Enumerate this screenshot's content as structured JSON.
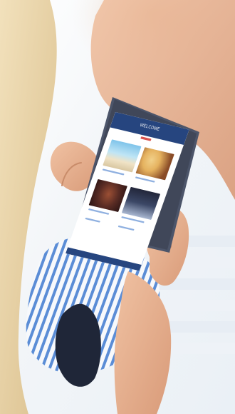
{
  "photo": {
    "subject": "person-holding-tablet",
    "colors": {
      "backdrop": "#f3efe9",
      "hair": "#e8d3a6",
      "skin": "#e3ad8c",
      "shirt_stripe_blue": "#5b8dd6",
      "shirt_white": "#f7f9fc",
      "tablet_body": "#4c556a",
      "screen_header": "#26457f",
      "screen_accent": "#d9534f"
    },
    "tablet_screen": {
      "header_title": "WELCOME",
      "tiles": [
        {
          "name": "beach-photo",
          "colors": [
            "#7fc4ea",
            "#f0e3c6"
          ]
        },
        {
          "name": "food-photo",
          "colors": [
            "#e5b25f",
            "#8a4c27"
          ]
        },
        {
          "name": "event-photo",
          "colors": [
            "#5a2c24",
            "#2b1414"
          ]
        },
        {
          "name": "performance-photo",
          "colors": [
            "#22263a",
            "#a9b7d1"
          ]
        }
      ]
    }
  }
}
